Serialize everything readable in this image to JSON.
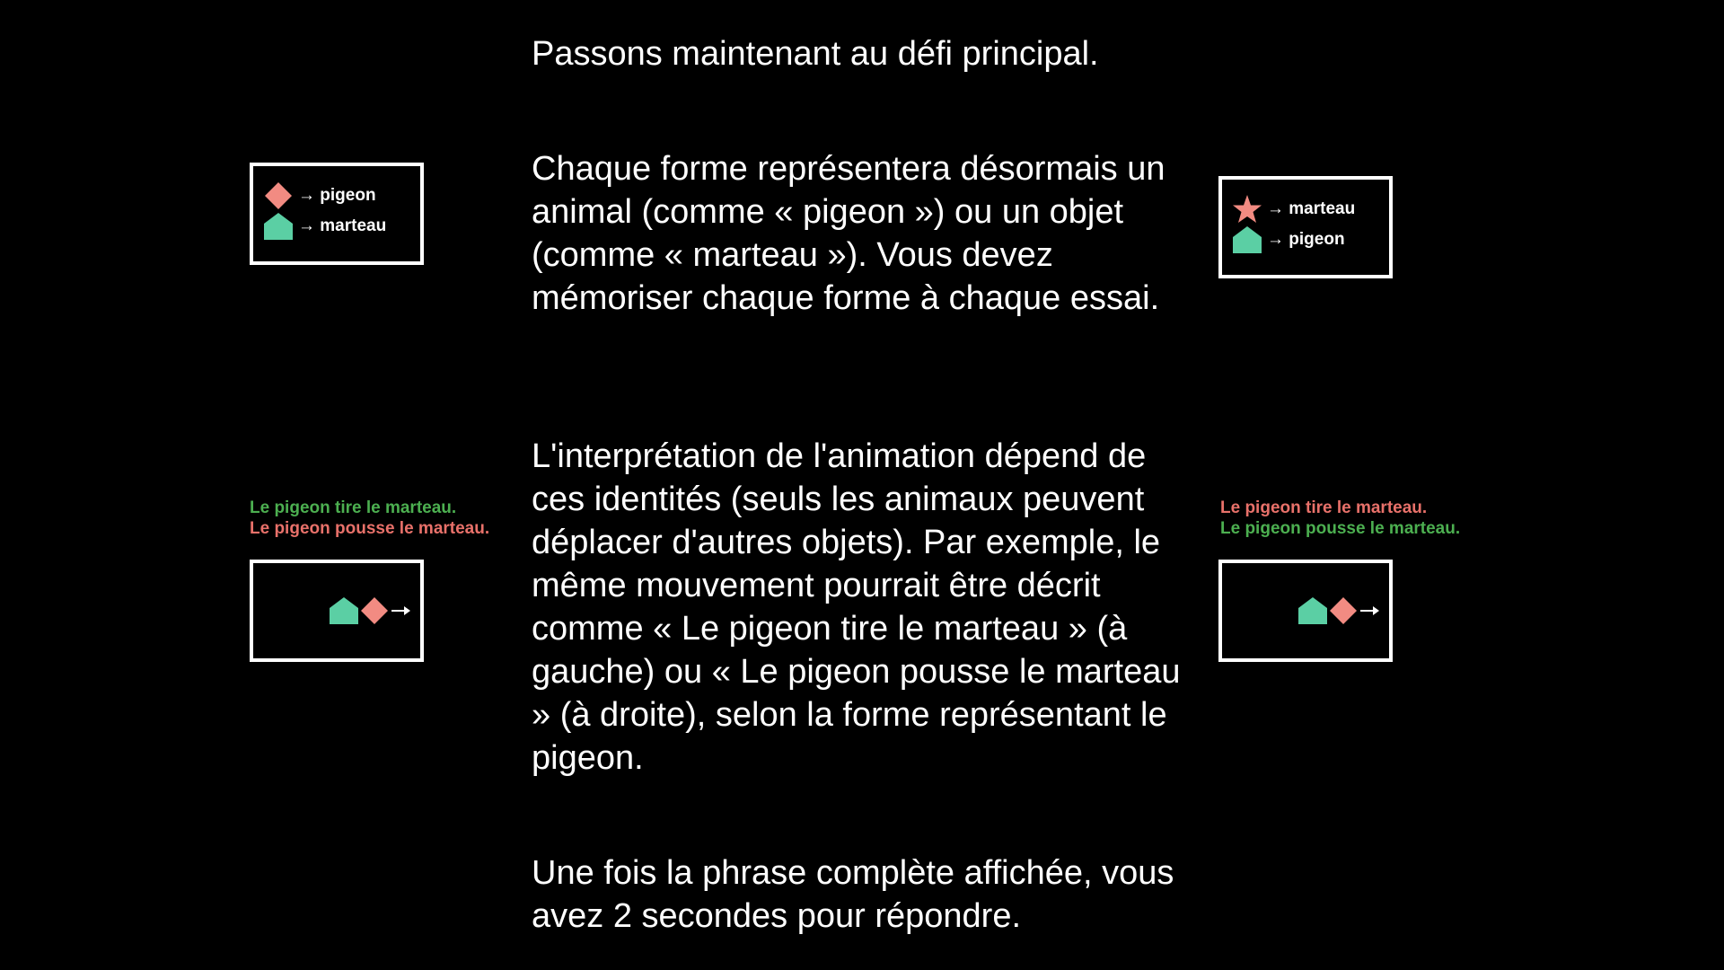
{
  "paragraphs": {
    "p1": "Passons maintenant au défi principal.",
    "p2": "Chaque forme représentera désormais un animal (comme « pigeon ») ou un objet (comme « marteau »). Vous devez mémoriser chaque forme à chaque essai.",
    "p3": "L'interprétation de l'animation dépend de ces identités (seuls les animaux peuvent déplacer d'autres objets). Par exemple, le même mouvement pourrait être décrit comme « Le pigeon tire le marteau » (à gauche) ou « Le pigeon pousse le marteau » (à droite), selon la forme représentant le pigeon.",
    "p4": "Une fois la phrase complète affichée, vous avez 2 secondes pour répondre."
  },
  "legend_left": {
    "rows": [
      {
        "icon": "diamond-icon",
        "label": "→ pigeon"
      },
      {
        "icon": "house-icon",
        "label": "→ marteau"
      }
    ]
  },
  "legend_right": {
    "rows": [
      {
        "icon": "star-icon",
        "label": "→ marteau"
      },
      {
        "icon": "house-icon",
        "label": "→ pigeon"
      }
    ]
  },
  "captions_left": {
    "line1": "Le pigeon tire le marteau.",
    "line2": "Le pigeon pousse le marteau."
  },
  "captions_right": {
    "line1": "Le pigeon tire le marteau.",
    "line2": "Le pigeon pousse le marteau."
  },
  "colors": {
    "background": "#000000",
    "text": "#ffffff",
    "salmon": "#f28b82",
    "teal": "#5bcfa4",
    "green": "#4caf50",
    "red": "#e8716a"
  }
}
